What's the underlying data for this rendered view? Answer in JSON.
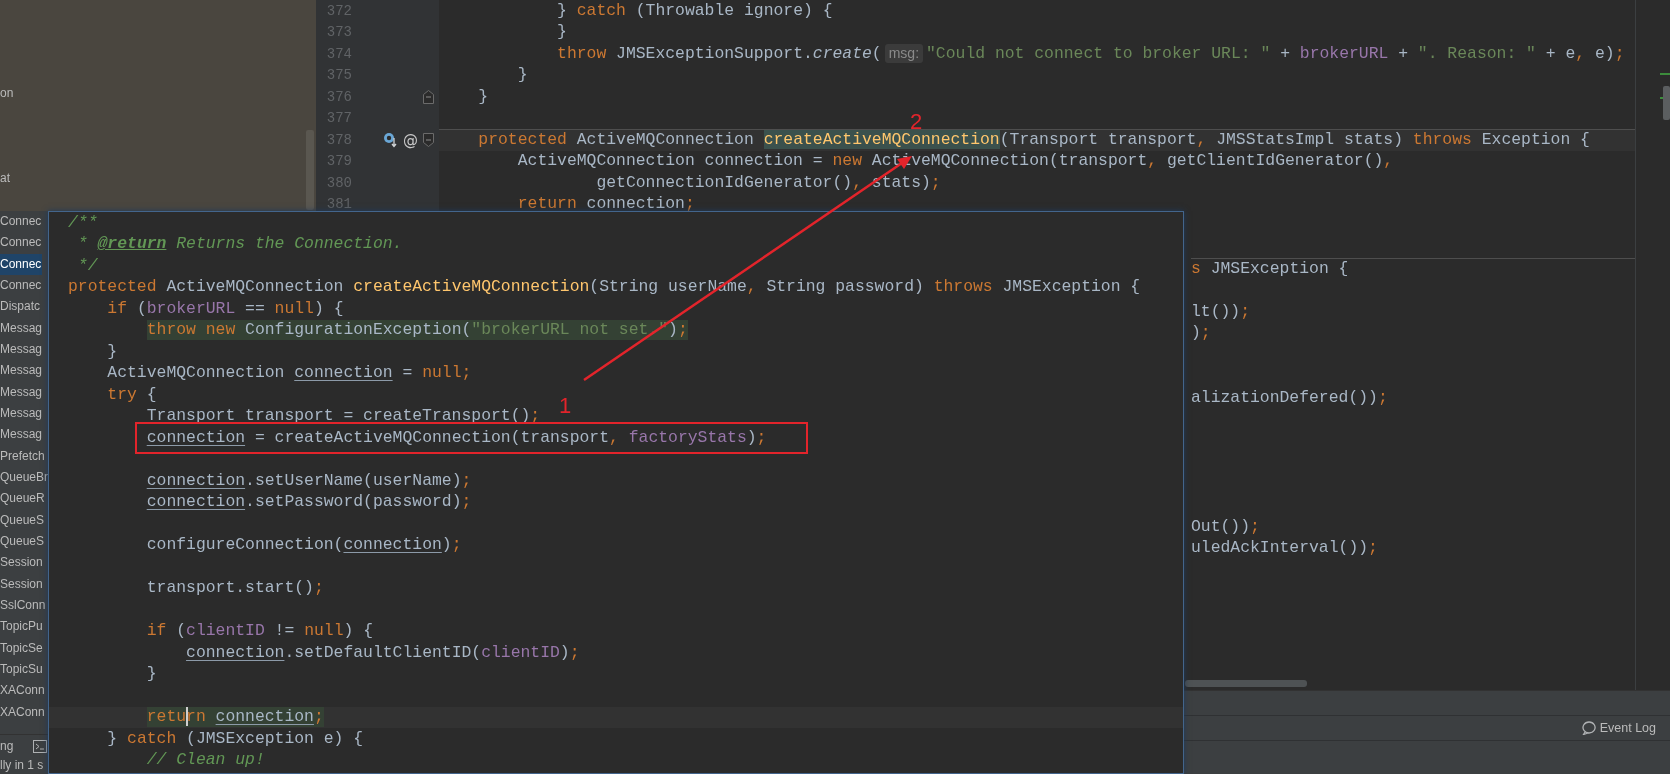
{
  "project_tree": {
    "top_items": [
      {
        "text": "on",
        "selected": false
      },
      {
        "text": "at",
        "selected": false
      }
    ],
    "items": [
      {
        "text": "Connec",
        "selected": false
      },
      {
        "text": "Connec",
        "selected": false
      },
      {
        "text": "Connec",
        "selected": true
      },
      {
        "text": "Connec",
        "selected": false
      },
      {
        "text": "Dispatc",
        "selected": false
      },
      {
        "text": "Messag",
        "selected": false
      },
      {
        "text": "Messag",
        "selected": false
      },
      {
        "text": "Messag",
        "selected": false
      },
      {
        "text": "Messag",
        "selected": false
      },
      {
        "text": "Messag",
        "selected": false
      },
      {
        "text": "Messag",
        "selected": false
      },
      {
        "text": "Prefetch",
        "selected": false
      },
      {
        "text": "QueueBr",
        "selected": false
      },
      {
        "text": "QueueR",
        "selected": false
      },
      {
        "text": "QueueS",
        "selected": false
      },
      {
        "text": "QueueS",
        "selected": false
      },
      {
        "text": "Session",
        "selected": false
      },
      {
        "text": "Session",
        "selected": false
      },
      {
        "text": "SslConn",
        "selected": false
      },
      {
        "text": "TopicPu",
        "selected": false
      },
      {
        "text": "TopicSe",
        "selected": false
      },
      {
        "text": "TopicSu",
        "selected": false
      },
      {
        "text": "XAConn",
        "selected": false
      },
      {
        "text": "XAConn",
        "selected": false
      }
    ]
  },
  "editor": {
    "lines": [
      {
        "number": "372",
        "kind": "code",
        "tokens": [
          {
            "kind": "plain",
            "text": "            } "
          },
          {
            "kind": "keyword",
            "text": "catch "
          },
          {
            "kind": "plain",
            "text": "(Throwable ignore) {"
          }
        ]
      },
      {
        "number": "373",
        "kind": "code",
        "tokens": [
          {
            "kind": "plain",
            "text": "            }"
          }
        ]
      },
      {
        "number": "374",
        "kind": "code",
        "tokens": [
          {
            "kind": "keyword",
            "text": "            throw "
          },
          {
            "kind": "plain",
            "text": "JMSExceptionSupport."
          },
          {
            "kind": "static",
            "text": "create"
          },
          {
            "kind": "plain",
            "text": "("
          },
          {
            "kind": "hint",
            "text": "msg:"
          },
          {
            "kind": "string",
            "text": "\"Could not connect to broker URL: \""
          },
          {
            "kind": "plain",
            "text": " + "
          },
          {
            "kind": "field",
            "text": "brokerURL"
          },
          {
            "kind": "plain",
            "text": " + "
          },
          {
            "kind": "string",
            "text": "\". Reason: \""
          },
          {
            "kind": "plain",
            "text": " + e"
          },
          {
            "kind": "punct",
            "text": ", "
          },
          {
            "kind": "plain",
            "text": "e)"
          },
          {
            "kind": "punct",
            "text": ";"
          }
        ]
      },
      {
        "number": "375",
        "kind": "code",
        "tokens": [
          {
            "kind": "plain",
            "text": "        }"
          }
        ]
      },
      {
        "number": "376",
        "kind": "fold-end",
        "tokens": [
          {
            "kind": "plain",
            "text": "    }"
          }
        ]
      },
      {
        "number": "377",
        "kind": "code"
      },
      {
        "number": "378",
        "kind": "fold-start",
        "separator": true,
        "current": true,
        "override": true,
        "gutter_mark": "@",
        "tokens": [
          {
            "kind": "keyword",
            "text": "    protected "
          },
          {
            "kind": "plain",
            "text": "ActiveMQConnection "
          },
          {
            "kind": "declaration-match",
            "text": "createActiveMQConnection"
          },
          {
            "kind": "plain",
            "text": "(Transport transport"
          },
          {
            "kind": "punct",
            "text": ", "
          },
          {
            "kind": "plain",
            "text": "JMSStatsImpl stats) "
          },
          {
            "kind": "keyword",
            "text": "throws "
          },
          {
            "kind": "plain",
            "text": "Exception {"
          }
        ]
      },
      {
        "number": "379",
        "kind": "code",
        "tokens": [
          {
            "kind": "plain",
            "text": "        ActiveMQConnection connection = "
          },
          {
            "kind": "keyword",
            "text": "new "
          },
          {
            "kind": "plain",
            "text": "ActiveMQConnection(transport"
          },
          {
            "kind": "punct",
            "text": ", "
          },
          {
            "kind": "plain",
            "text": "getClientIdGenerator()"
          },
          {
            "kind": "punct",
            "text": ","
          }
        ]
      },
      {
        "number": "380",
        "kind": "code",
        "tokens": [
          {
            "kind": "plain",
            "text": "                getConnectionIdGenerator()"
          },
          {
            "kind": "punct",
            "text": ", "
          },
          {
            "kind": "plain",
            "text": "stats)"
          },
          {
            "kind": "punct",
            "text": ";"
          }
        ]
      },
      {
        "number": "381",
        "kind": "code",
        "tokens": [
          {
            "kind": "keyword",
            "text": "        return "
          },
          {
            "kind": "plain",
            "text": "connection"
          },
          {
            "kind": "punct",
            "text": ";"
          }
        ]
      }
    ],
    "partial_lines": [
      {
        "separator": true,
        "tokens": [
          {
            "kind": "keyword",
            "text": "s "
          },
          {
            "kind": "plain",
            "text": "JMSException {"
          }
        ]
      },
      {
        "separator": false,
        "tokens": [
          {
            "kind": "plain",
            "text": "lt())"
          },
          {
            "kind": "punct",
            "text": ";"
          }
        ]
      },
      {
        "separator": false,
        "tokens": [
          {
            "kind": "plain",
            "text": ")"
          },
          {
            "kind": "punct",
            "text": ";"
          }
        ]
      },
      {
        "separator": false,
        "tokens": [
          {
            "kind": "plain",
            "text": "alizationDefered())"
          },
          {
            "kind": "punct",
            "text": ";"
          }
        ]
      },
      {
        "separator": false,
        "tokens": [
          {
            "kind": "plain",
            "text": "Out())"
          },
          {
            "kind": "punct",
            "text": ";"
          }
        ]
      },
      {
        "separator": false,
        "tokens": [
          {
            "kind": "plain",
            "text": "uledAckInterval())"
          },
          {
            "kind": "punct",
            "text": ";"
          }
        ]
      }
    ]
  },
  "popup": {
    "blocks": [
      {
        "lines": [
          {
            "tokens": [
              {
                "kind": "comment",
                "text": "/**"
              }
            ]
          },
          {
            "tokens": [
              {
                "kind": "comment",
                "text": " * "
              },
              {
                "kind": "doctag",
                "text": "@return"
              },
              {
                "kind": "comment",
                "text": " Returns the Connection."
              }
            ]
          },
          {
            "tokens": [
              {
                "kind": "comment",
                "text": " */"
              }
            ]
          },
          {
            "tokens": [
              {
                "kind": "keyword",
                "text": "protected "
              },
              {
                "kind": "plain",
                "text": "ActiveMQConnection "
              },
              {
                "kind": "declaration",
                "text": "createActiveMQConnection"
              },
              {
                "kind": "plain",
                "text": "(String userName"
              },
              {
                "kind": "punct",
                "text": ", "
              },
              {
                "kind": "plain",
                "text": "String password) "
              },
              {
                "kind": "keyword",
                "text": "throws "
              },
              {
                "kind": "plain",
                "text": "JMSException {"
              }
            ]
          },
          {
            "tokens": [
              {
                "kind": "keyword",
                "text": "    if "
              },
              {
                "kind": "plain",
                "text": "("
              },
              {
                "kind": "field",
                "text": "brokerURL"
              },
              {
                "kind": "plain",
                "text": " == "
              },
              {
                "kind": "keyword",
                "text": "null"
              },
              {
                "kind": "plain",
                "text": ") {"
              }
            ]
          },
          {
            "highlight": true,
            "tokens": [
              {
                "kind": "keyword",
                "text": "        throw new "
              },
              {
                "kind": "plain",
                "text": "ConfigurationException("
              },
              {
                "kind": "string",
                "text": "\"brokerURL not set.\""
              },
              {
                "kind": "plain",
                "text": ")"
              },
              {
                "kind": "punct",
                "text": ";"
              }
            ]
          },
          {
            "tokens": [
              {
                "kind": "plain",
                "text": "    }"
              }
            ]
          },
          {
            "tokens": [
              {
                "kind": "plain",
                "text": "    ActiveMQConnection "
              },
              {
                "kind": "reassigned",
                "text": "connection"
              },
              {
                "kind": "plain",
                "text": " = "
              },
              {
                "kind": "keyword",
                "text": "null"
              },
              {
                "kind": "punct",
                "text": ";"
              }
            ]
          },
          {
            "tokens": [
              {
                "kind": "keyword",
                "text": "    try "
              },
              {
                "kind": "plain",
                "text": "{"
              }
            ]
          },
          {
            "tokens": [
              {
                "kind": "plain",
                "text": "        Transport transport = createTransport()"
              },
              {
                "kind": "punct",
                "text": ";"
              }
            ]
          },
          {
            "boxed": true,
            "tokens": [
              {
                "kind": "reassigned",
                "text": "        connection"
              },
              {
                "kind": "plain",
                "text": " = createActiveMQConnection(transport"
              },
              {
                "kind": "punct",
                "text": ", "
              },
              {
                "kind": "field",
                "text": "factoryStats"
              },
              {
                "kind": "plain",
                "text": ")"
              },
              {
                "kind": "punct",
                "text": ";"
              }
            ]
          }
        ]
      },
      {
        "lines": [
          {
            "tokens": [
              {
                "kind": "reassigned",
                "text": "        connection"
              },
              {
                "kind": "plain",
                "text": ".setUserName(userName)"
              },
              {
                "kind": "punct",
                "text": ";"
              }
            ]
          },
          {
            "tokens": [
              {
                "kind": "reassigned",
                "text": "        connection"
              },
              {
                "kind": "plain",
                "text": ".setPassword(password)"
              },
              {
                "kind": "punct",
                "text": ";"
              }
            ]
          }
        ]
      },
      {
        "lines": [
          {
            "tokens": [
              {
                "kind": "plain",
                "text": "        configureConnection("
              },
              {
                "kind": "reassigned",
                "text": "connection"
              },
              {
                "kind": "plain",
                "text": ")"
              },
              {
                "kind": "punct",
                "text": ";"
              }
            ]
          }
        ]
      },
      {
        "lines": [
          {
            "tokens": [
              {
                "kind": "plain",
                "text": "        transport.start()"
              },
              {
                "kind": "punct",
                "text": ";"
              }
            ]
          }
        ]
      },
      {
        "lines": [
          {
            "tokens": [
              {
                "kind": "keyword",
                "text": "        if "
              },
              {
                "kind": "plain",
                "text": "("
              },
              {
                "kind": "field",
                "text": "clientID"
              },
              {
                "kind": "plain",
                "text": " != "
              },
              {
                "kind": "keyword",
                "text": "null"
              },
              {
                "kind": "plain",
                "text": ") {"
              }
            ]
          },
          {
            "tokens": [
              {
                "kind": "reassigned",
                "text": "            connection"
              },
              {
                "kind": "plain",
                "text": ".setDefaultClientID("
              },
              {
                "kind": "field",
                "text": "clientID"
              },
              {
                "kind": "plain",
                "text": ")"
              },
              {
                "kind": "punct",
                "text": ";"
              }
            ]
          },
          {
            "tokens": [
              {
                "kind": "plain",
                "text": "        }"
              }
            ]
          }
        ]
      },
      {
        "lines": [
          {
            "current": true,
            "highlight": true,
            "tokens": [
              {
                "kind": "keyword",
                "text": "        retu"
              },
              {
                "kind": "keyword",
                "text": "rn ",
                "caret": true
              },
              {
                "kind": "reassigned",
                "text": "connection"
              },
              {
                "kind": "punct",
                "text": ";"
              }
            ]
          },
          {
            "tokens": [
              {
                "kind": "plain",
                "text": "    } "
              },
              {
                "kind": "keyword",
                "text": "catch "
              },
              {
                "kind": "plain",
                "text": "(JMSException e) {"
              }
            ]
          },
          {
            "tokens": [
              {
                "kind": "comment",
                "text": "        // Clean up!"
              }
            ]
          }
        ]
      }
    ]
  },
  "annotations": [
    {
      "text": "1"
    },
    {
      "text": "2"
    }
  ],
  "bottom": {
    "tool_window_label": "ng",
    "status_text": "lly in 1 s",
    "event_log": "Event Log"
  }
}
